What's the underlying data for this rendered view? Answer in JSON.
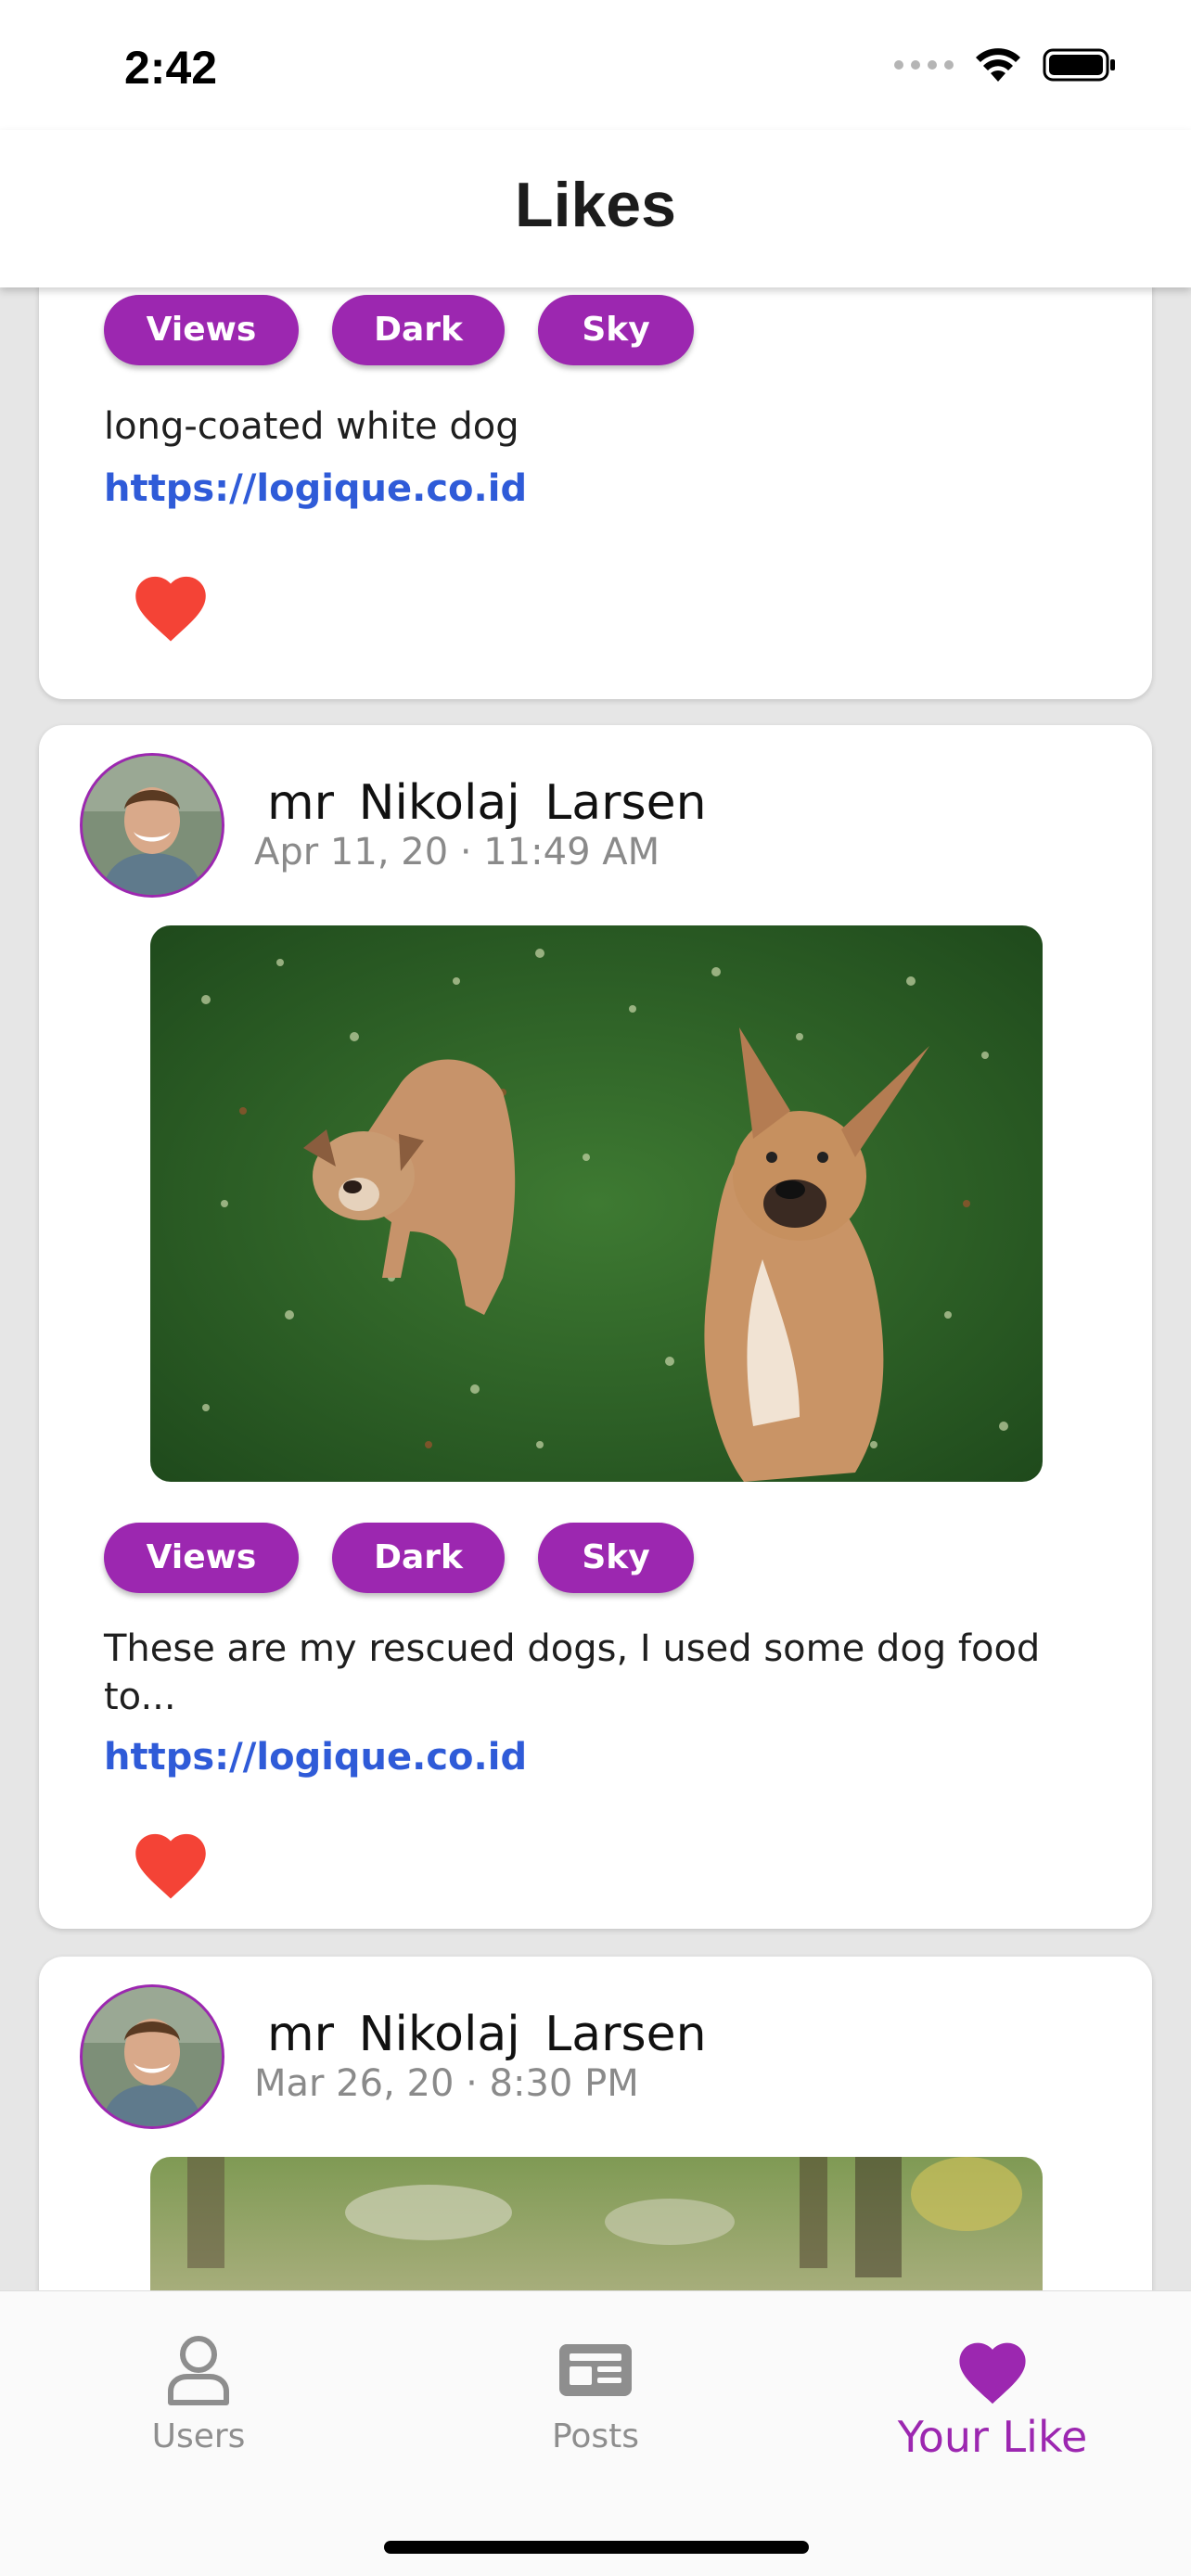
{
  "status_bar": {
    "time": "2:42"
  },
  "header": {
    "title": "Likes"
  },
  "posts": [
    {
      "tags": [
        "Views",
        "Dark",
        "Sky"
      ],
      "description": "long-coated white dog",
      "link": "https://logique.co.id",
      "liked": true
    },
    {
      "author": "mr  Nikolaj  Larsen",
      "date": "Apr 11, 20 · 11:49 AM",
      "tags": [
        "Views",
        "Dark",
        "Sky"
      ],
      "description": "These are my rescued dogs, I used some dog food to...",
      "link": "https://logique.co.id",
      "liked": true
    },
    {
      "author": "mr  Nikolaj  Larsen",
      "date": "Mar 26, 20 · 8:30 PM"
    }
  ],
  "tabs": [
    {
      "label": "Users",
      "icon": "user-icon"
    },
    {
      "label": "Posts",
      "icon": "newspaper-icon"
    },
    {
      "label": "Your Like",
      "icon": "heart-icon",
      "active": true
    }
  ],
  "colors": {
    "accent": "#9c27b0",
    "link": "#2f5bd8",
    "heart": "#f44336"
  }
}
